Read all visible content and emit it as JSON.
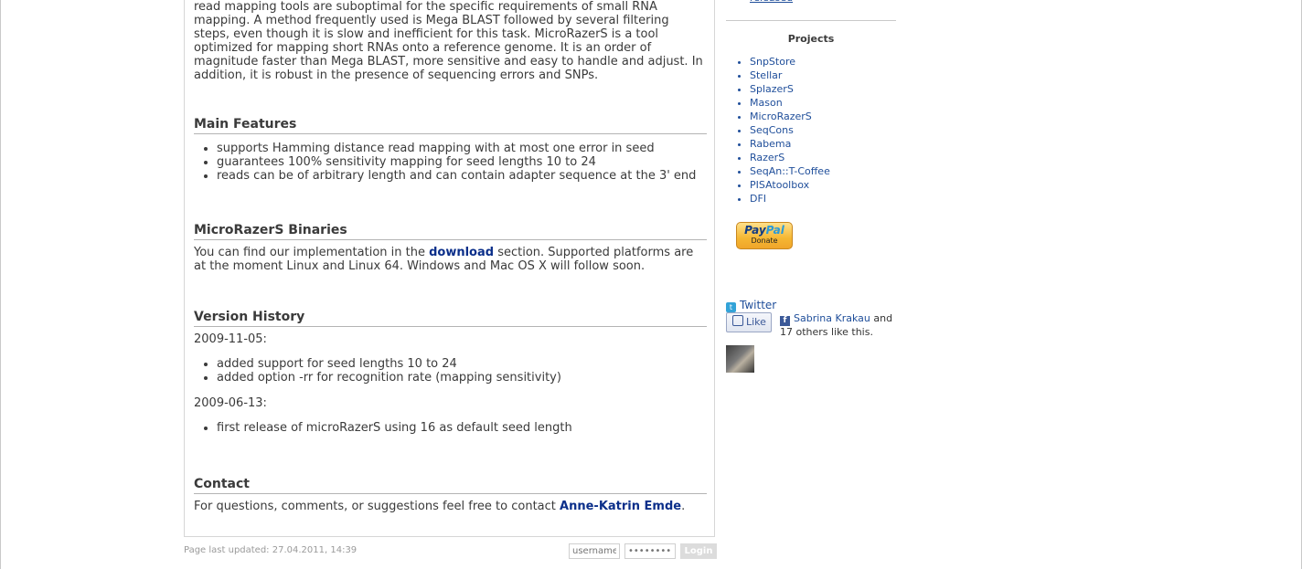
{
  "intro_lines": "read mapping tools are suboptimal for the specific requirements of small RNA mapping. A method frequently used is Mega BLAST followed by several filtering steps, even though it is slow and inefficient for this task. MicroRazerS is a tool optimized for mapping short RNAs onto a reference genome. It is an order of magnitude faster than Mega BLAST, more sensitive and easy to handle and adjust. In addition, it is robust in the presence of sequencing errors and SNPs.",
  "features": {
    "title": "Main Features",
    "items": [
      "supports Hamming distance read mapping with at most one error in seed",
      "guarantees 100% sensitivity mapping for seed lengths 10 to 24",
      "reads can be of arbitrary length and can contain adapter sequence at the 3' end"
    ]
  },
  "binaries": {
    "title": "MicroRazerS Binaries",
    "text_before": "You can find our implementation in the ",
    "link": "download",
    "text_after": " section. Supported platforms are at the moment Linux and Linux 64. Windows and Mac OS X will follow soon."
  },
  "history": {
    "title": "Version History",
    "entries": [
      {
        "date": "2009-11-05:",
        "items": [
          "added support for seed lengths 10 to 24",
          "added option -rr for recognition rate (mapping sensitivity)"
        ]
      },
      {
        "date": "2009-06-13:",
        "items": [
          "first release of microRazerS using 16 as default seed length"
        ]
      }
    ]
  },
  "contact": {
    "title": "Contact",
    "text": "For questions, comments, or suggestions feel free to contact ",
    "link": "Anne-Katrin Emde",
    "end": "."
  },
  "sidebar": {
    "released": "released",
    "projects_title": "Projects",
    "projects": [
      "SnpStore",
      "Stellar",
      "SplazerS",
      "Mason",
      "MicroRazerS",
      "SeqCons",
      "Rabema",
      "RazerS",
      "SeqAn::T-Coffee",
      "PISAtoolbox",
      "DFI"
    ],
    "paypal_pay": "Pay",
    "paypal_pal": "Pal",
    "paypal_donate": "Donate",
    "twitter": "Twitter",
    "like": "Like",
    "fb_name": "Sabrina Krakau",
    "fb_and": " and",
    "fb_others": "17 others like this."
  },
  "footer": {
    "updated": "Page last updated: 27.04.2011, 14:39",
    "username_placeholder": "username",
    "password_placeholder": "•••••••••",
    "login": "Login"
  }
}
